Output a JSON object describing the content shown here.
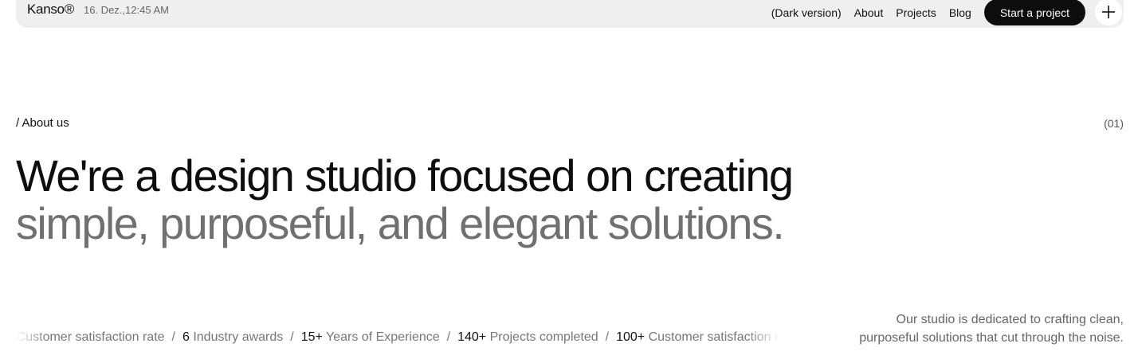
{
  "header": {
    "brand": "Kanso®",
    "datetime": "16. Dez.,12:45 AM",
    "nav": [
      "(Dark version)",
      "About",
      "Projects",
      "Blog"
    ],
    "cta": "Start a project",
    "menu_icon": "plus-icon"
  },
  "about": {
    "label": "/ About us",
    "number": "(01)",
    "headline_line1": "We're a design studio focused on creating",
    "headline_line2": "simple, purposeful, and elegant solutions.",
    "description": "Our studio is dedicated to crafting clean, purposeful solutions that cut through the noise."
  },
  "stats": [
    {
      "number": "%",
      "label": " Customer satisfaction rate"
    },
    {
      "number": "6",
      "label": " Industry awards"
    },
    {
      "number": "15+",
      "label": " Years of Experience"
    },
    {
      "number": "140+",
      "label": " Projects completed"
    },
    {
      "number": "100+",
      "label": " Customer satisfaction rate"
    }
  ],
  "stat_separator": "/",
  "colors": {
    "navbar_bg": "#efefef",
    "cta_bg": "#0d0d0d",
    "headline_primary": "#0e0e0e",
    "headline_secondary": "#707070"
  }
}
